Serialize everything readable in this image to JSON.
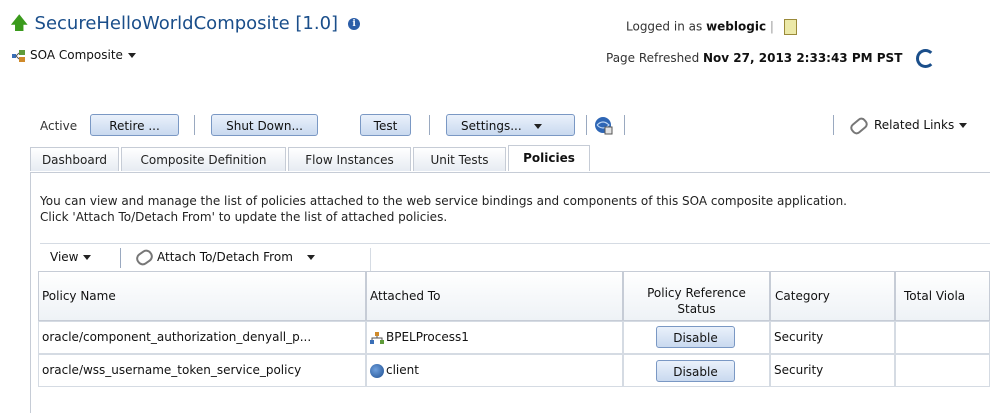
{
  "header": {
    "title": "SecureHelloWorldComposite [1.0]",
    "composite_type": "SOA Composite",
    "logged_in_prefix": "Logged in as",
    "user": "weblogic",
    "refreshed_prefix": "Page Refreshed",
    "refreshed_time": "Nov 27, 2013 2:33:43 PM PST"
  },
  "toolbar": {
    "status": "Active",
    "retire": "Retire ...",
    "shutdown": "Shut Down...",
    "test": "Test",
    "settings": "Settings...",
    "related_links": "Related Links"
  },
  "tabs": [
    "Dashboard",
    "Composite Definition",
    "Flow Instances",
    "Unit Tests",
    "Policies"
  ],
  "active_tab": "Policies",
  "description": {
    "line1": "You can view and manage the list of policies attached to the web service bindings and components of this SOA composite application.",
    "line2": "Click 'Attach To/Detach From' to update the list of attached policies."
  },
  "table_toolbar": {
    "view": "View",
    "attach": "Attach To/Detach From"
  },
  "table": {
    "columns": [
      "Policy Name",
      "Attached To",
      "Policy Reference Status",
      "Category",
      "Total Viola"
    ],
    "col_status_line1": "Policy Reference",
    "col_status_line2": "Status",
    "rows": [
      {
        "policy": "oracle/component_authorization_denyall_p...",
        "attached": "BPELProcess1",
        "status": "Disable",
        "category": "Security"
      },
      {
        "policy": "oracle/wss_username_token_service_policy",
        "attached": "client",
        "status": "Disable",
        "category": "Security"
      }
    ]
  },
  "colors": {
    "title": "#1a4e8a",
    "up_arrow": "#3a9a1c",
    "button_border": "#7a98c4"
  }
}
